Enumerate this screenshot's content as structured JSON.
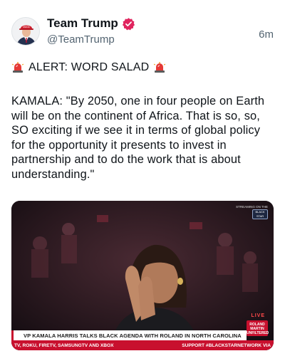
{
  "post": {
    "display_name": "Team Trump",
    "handle": "@TeamTrump",
    "time": "6m",
    "alert": "ALERT: WORD SALAD",
    "body": "KAMALA: \"By 2050, one in four people on Earth will be on the continent of Africa. That is so, so, SO exciting if we see it in terms of global policy for the opportunity it presents to invest in partnership and to do the work that is about understanding.\""
  },
  "media": {
    "watermark": "STREAMING ON THE",
    "network_logo": "BLACK STAR",
    "live": "LIVE",
    "show_logo": "ROLAND MARTIN UNFILTERED",
    "headline": "VP KAMALA HARRIS TALKS BLACK AGENDA WITH ROLAND IN NORTH CAROLINA",
    "ticker_left": "TV, ROKU, FIRETV, SAMSUNGTV AND XBOX",
    "ticker_right": "SUPPORT #BLACKSTARNETWORK VIA"
  },
  "icons": {
    "avatar": "profile-photo",
    "verified": "verified-badge-icon",
    "siren": "police-siren-emoji"
  },
  "colors": {
    "text": "#0f1419",
    "secondary": "#536471",
    "verified": "#e0245e",
    "ticker_red": "#c8102e"
  }
}
